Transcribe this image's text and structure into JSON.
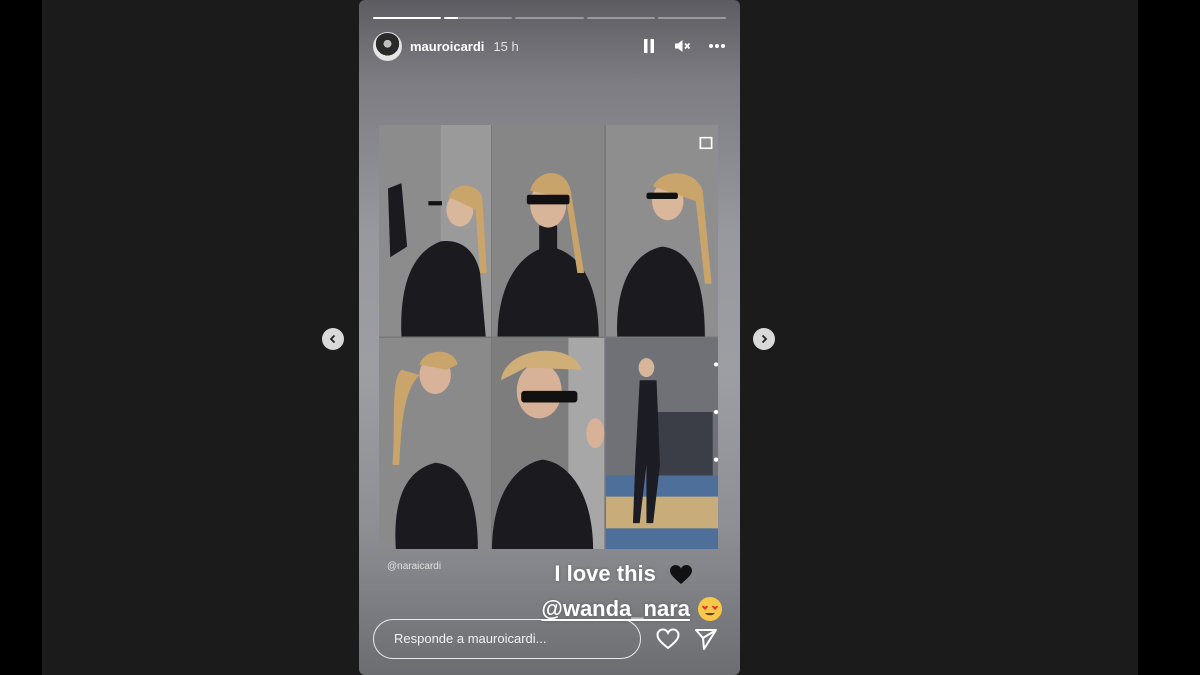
{
  "story": {
    "username": "mauroicardi",
    "time_ago": "15 h",
    "progress": [
      1,
      0.2,
      0,
      0,
      0
    ],
    "photo_credit": "@naraicardi",
    "caption_line1": "I love this",
    "caption_mention": "@wanda_nara",
    "reply_placeholder": "Responde a mauroicardi..."
  },
  "icons": {
    "pause": "pause-icon",
    "mute": "mute-icon",
    "more": "more-icon",
    "like": "heart-icon",
    "share": "send-icon",
    "prev": "chevron-left-icon",
    "next": "chevron-right-icon"
  },
  "colors": {
    "stage_bg": "#1b1b1b",
    "page_bg": "#000000",
    "text": "#ffffff"
  }
}
